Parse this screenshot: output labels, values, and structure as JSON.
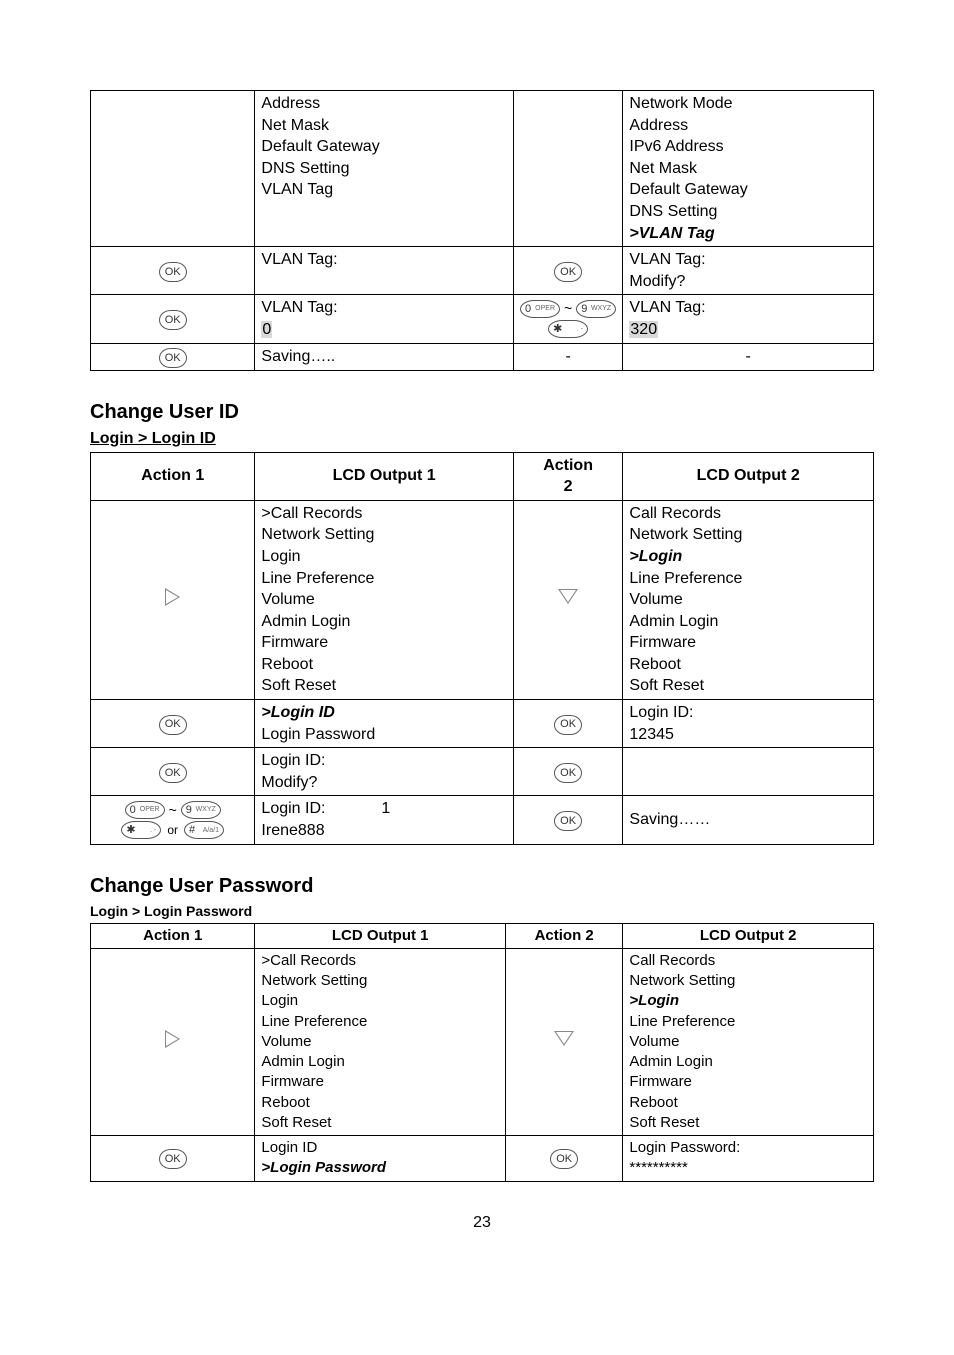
{
  "page_number": "23",
  "table1": {
    "rows": [
      {
        "a1": "",
        "lines1": [
          "Address",
          "Net Mask",
          "Default Gateway",
          "DNS Setting",
          "VLAN Tag"
        ],
        "a2": "",
        "lines2": [
          "Network Mode",
          "Address",
          "IPv6 Address",
          "Net Mask",
          "Default Gateway",
          "DNS Setting"
        ],
        "lines2_bold": ">VLAN Tag"
      },
      {
        "a1": "ok",
        "l1": "VLAN Tag:",
        "a2": "ok",
        "l2a": "VLAN Tag:",
        "l2b": "Modify?"
      },
      {
        "a1": "ok",
        "l1a": "VLAN Tag:",
        "l1b_hl": "0",
        "a2": "numstar",
        "l2a": "VLAN Tag:",
        "l2b_hl": "320"
      },
      {
        "a1": "ok",
        "l1": "Saving…..",
        "a2": "-",
        "l2": "-"
      }
    ]
  },
  "sec2": {
    "heading": "Change User ID",
    "breadcrumb": "Login > Login ID",
    "headers": [
      "Action 1",
      "LCD Output 1",
      "Action\n2",
      "LCD Output 2"
    ],
    "rows": [
      {
        "a1": "tri-right",
        "lines1": [
          " >Call Records",
          "Network Setting",
          "Login",
          "Line Preference",
          "Volume",
          "Admin Login",
          "Firmware",
          "Reboot",
          "Soft Reset"
        ],
        "a2": "tri-down",
        "lines2": [
          "Call Records",
          "Network Setting"
        ],
        "lines2_bold": ">Login",
        "lines2_after": [
          "Line Preference",
          "Volume",
          "Admin Login",
          "Firmware",
          "Reboot",
          "Soft Reset"
        ]
      },
      {
        "a1": "ok",
        "l1_bold": ">Login ID",
        "l1b": "Login Password",
        "a2": "ok",
        "l2a": "Login ID:",
        "l2b": "12345"
      },
      {
        "a1": "ok",
        "l1a": "Login ID:",
        "l1b": "Modify?",
        "a2": "ok",
        "l2": ""
      },
      {
        "a1": "numstar_hash_or",
        "l1a": "Login ID:",
        "num1": "1",
        "l1b": "Irene888",
        "a2": "ok",
        "l2": "Saving……"
      }
    ]
  },
  "sec3": {
    "heading": "Change User Password",
    "breadcrumb": "Login > Login Password",
    "headers": [
      "Action 1",
      "LCD Output 1",
      "Action 2",
      "LCD Output 2"
    ],
    "rows": [
      {
        "a1": "tri-right",
        "lines1": [
          " >Call Records",
          "Network Setting",
          "Login",
          "Line Preference",
          "Volume",
          "Admin Login",
          "Firmware",
          "Reboot",
          "Soft Reset"
        ],
        "a2": "tri-down",
        "lines2": [
          "Call Records",
          "Network Setting"
        ],
        "lines2_bold": ">Login",
        "lines2_after": [
          "Line Preference",
          "Volume",
          "Admin Login",
          "Firmware",
          "Reboot",
          "Soft Reset"
        ]
      },
      {
        "a1": "ok",
        "l1a": "Login ID",
        "l1_bold": ">Login Password",
        "a2": "ok",
        "l2a": "Login Password:",
        "l2b": "**********"
      }
    ]
  }
}
